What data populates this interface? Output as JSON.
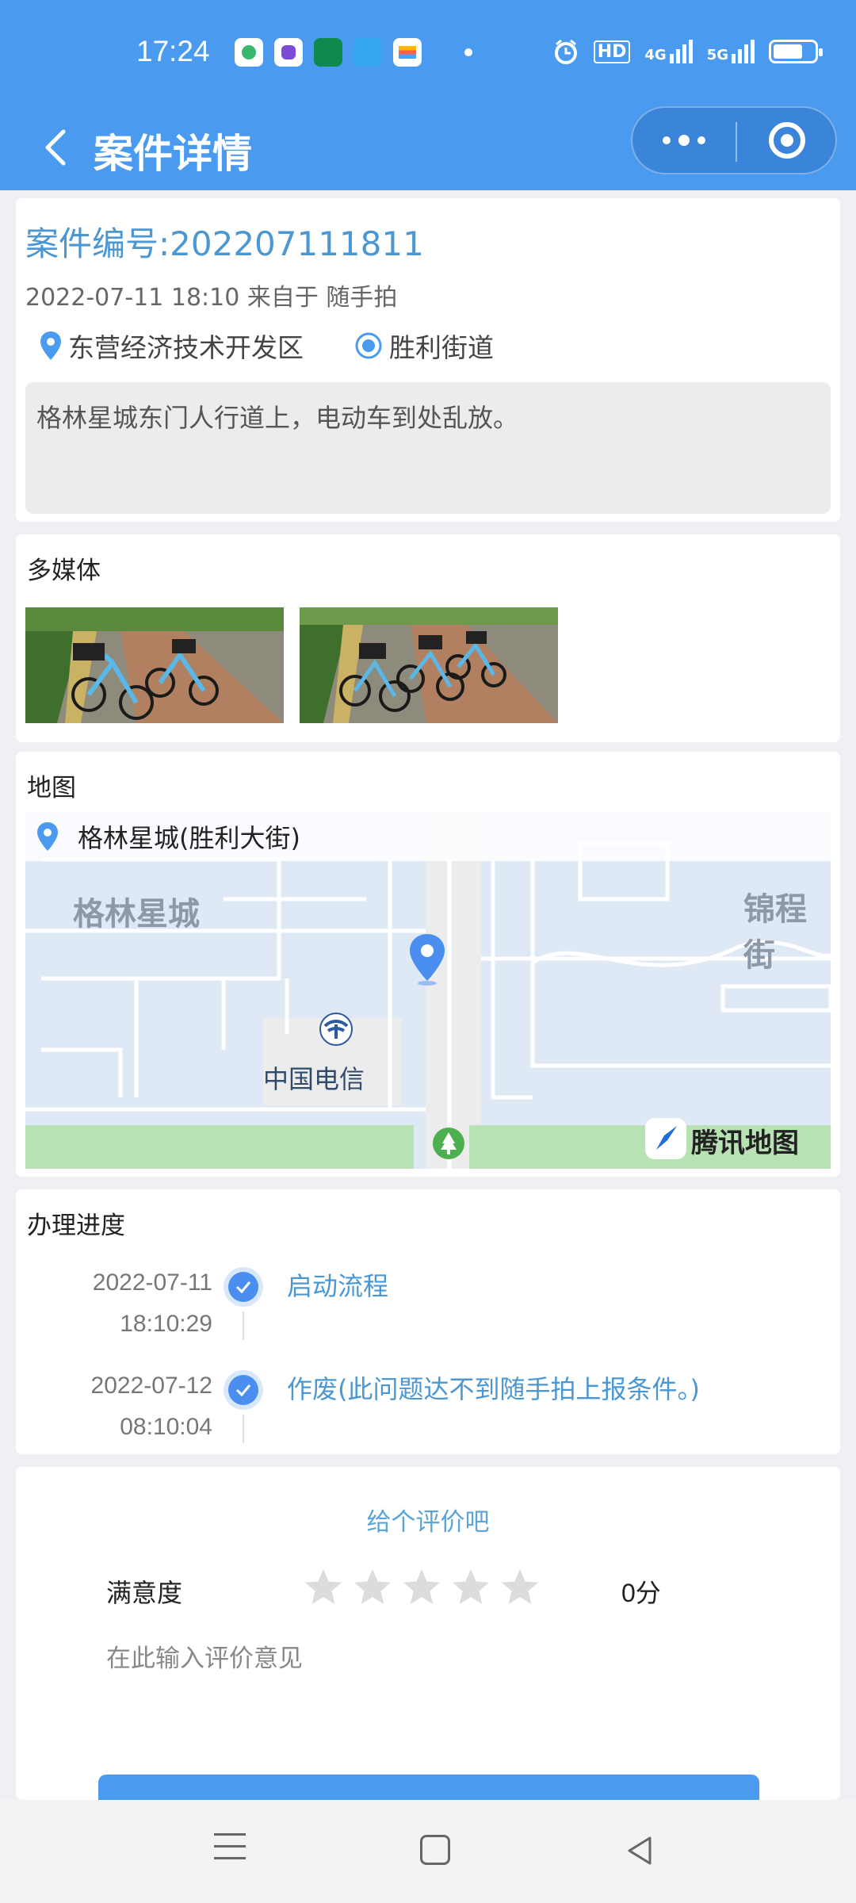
{
  "status_bar": {
    "time": "17:24",
    "network_labels": [
      "HD",
      "4G",
      "5G"
    ]
  },
  "header": {
    "title": "案件详情",
    "back_icon": "chevron-left-icon",
    "more_icon": "more-dots-icon",
    "close_icon": "target-circle-icon"
  },
  "case": {
    "number_label": "案件编号:202207111811",
    "meta": "2022-07-11 18:10 来自于 随手拍",
    "district": "东营经济技术开发区",
    "street": "胜利街道",
    "description": "格林星城东门人行道上，电动车到处乱放。"
  },
  "media": {
    "title": "多媒体"
  },
  "map": {
    "title": "地图",
    "location": "格林星城(胜利大街)",
    "labels": {
      "area1": "格林星城",
      "area2": "锦程街",
      "poi": "中国电信",
      "brand": "腾讯地图"
    }
  },
  "progress": {
    "title": "办理进度",
    "steps": [
      {
        "date": "2022-07-11",
        "time": "18:10:29",
        "label": "启动流程"
      },
      {
        "date": "2022-07-12",
        "time": "08:10:04",
        "label": "作废(此问题达不到随手拍上报条件。)"
      }
    ]
  },
  "rating": {
    "title": "给个评价吧",
    "satisfaction_label": "满意度",
    "stars_selected": 0,
    "stars_total": 5,
    "score": "0分",
    "comment_placeholder": "在此输入评价意见"
  },
  "colors": {
    "brand_blue": "#4a9bf0",
    "link_blue": "#4b97d3"
  }
}
